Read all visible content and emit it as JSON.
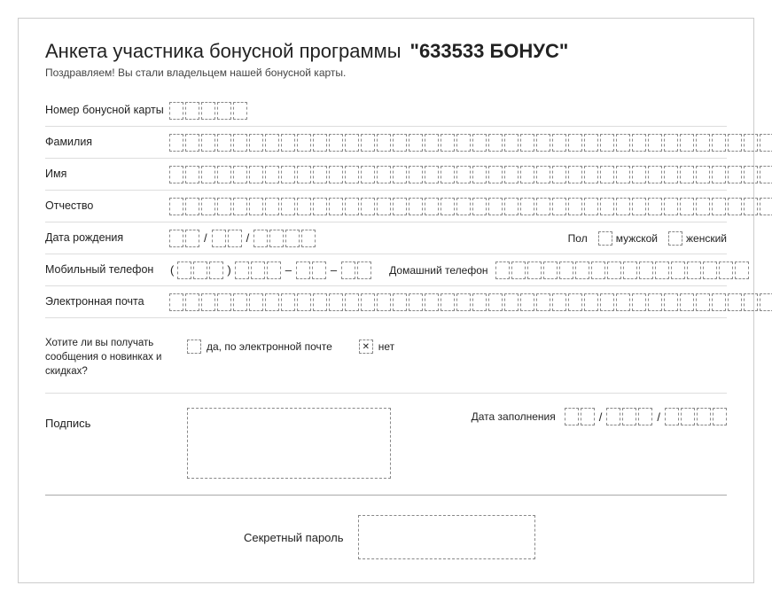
{
  "page": {
    "title_main": "Анкета участника бонусной программы",
    "title_brand": "\"633533 БОНУС\"",
    "subtitle": "Поздравляем! Вы стали владельцем нашей бонусной карты.",
    "fields": {
      "bonus_card_label": "Номер бонусной карты",
      "last_name_label": "Фамилия",
      "first_name_label": "Имя",
      "patronymic_label": "Отчество",
      "birth_date_label": "Дата рождения",
      "gender_label": "Пол",
      "gender_male": "мужской",
      "gender_female": "женский",
      "mobile_phone_label": "Мобильный телефон",
      "home_phone_label": "Домашний телефон",
      "email_label": "Электронная почта",
      "notice_label": "Хотите ли вы получать сообщения о новинках и скидках?",
      "notice_yes": "да, по электронной почте",
      "notice_no": "нет",
      "signature_label": "Подпись",
      "date_fill_label": "Дата заполнения",
      "secret_label": "Секретный пароль"
    },
    "bonus_card_boxes": 5,
    "long_field_boxes": 38,
    "date_day_boxes": 2,
    "date_month_boxes": 2,
    "date_year_boxes": 4,
    "mobile_area_code_boxes": 3,
    "mobile_part1_boxes": 3,
    "mobile_part2_boxes": 2,
    "mobile_part3_boxes": 2,
    "home_phone_boxes": 16,
    "fill_date_day_boxes": 2,
    "fill_date_month_boxes": 3,
    "fill_date_year_boxes": 4
  }
}
